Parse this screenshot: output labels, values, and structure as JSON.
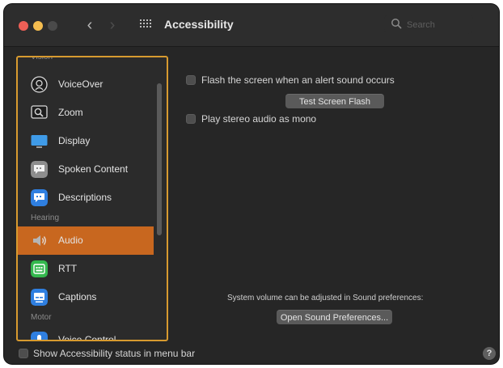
{
  "window": {
    "title": "Accessibility",
    "search": {
      "placeholder": "Search"
    }
  },
  "sidebar": {
    "sections": {
      "vision": "Vision",
      "hearing": "Hearing",
      "motor": "Motor"
    },
    "items": [
      {
        "label": "VoiceOver",
        "icon": "voiceover-icon"
      },
      {
        "label": "Zoom",
        "icon": "zoom-icon"
      },
      {
        "label": "Display",
        "icon": "display-icon"
      },
      {
        "label": "Spoken Content",
        "icon": "spoken-content-icon"
      },
      {
        "label": "Descriptions",
        "icon": "descriptions-icon"
      },
      {
        "label": "Audio",
        "icon": "audio-speaker-icon",
        "selected": true
      },
      {
        "label": "RTT",
        "icon": "rtt-icon"
      },
      {
        "label": "Captions",
        "icon": "captions-icon"
      },
      {
        "label": "Voice Control",
        "icon": "voice-control-icon"
      }
    ]
  },
  "audio": {
    "flash_label": "Flash the screen when an alert sound occurs",
    "flash_checked": false,
    "test_flash_button": "Test Screen Flash",
    "mono_label": "Play stereo audio as mono",
    "mono_checked": false,
    "sound_note": "System volume can be adjusted in Sound preferences:",
    "open_sound_button": "Open Sound Preferences..."
  },
  "footer": {
    "status_menu_label": "Show Accessibility status in menu bar",
    "status_menu_checked": false,
    "help": "?"
  },
  "colors": {
    "accent": "#c8671f",
    "highlight_border": "#d79a2f"
  }
}
